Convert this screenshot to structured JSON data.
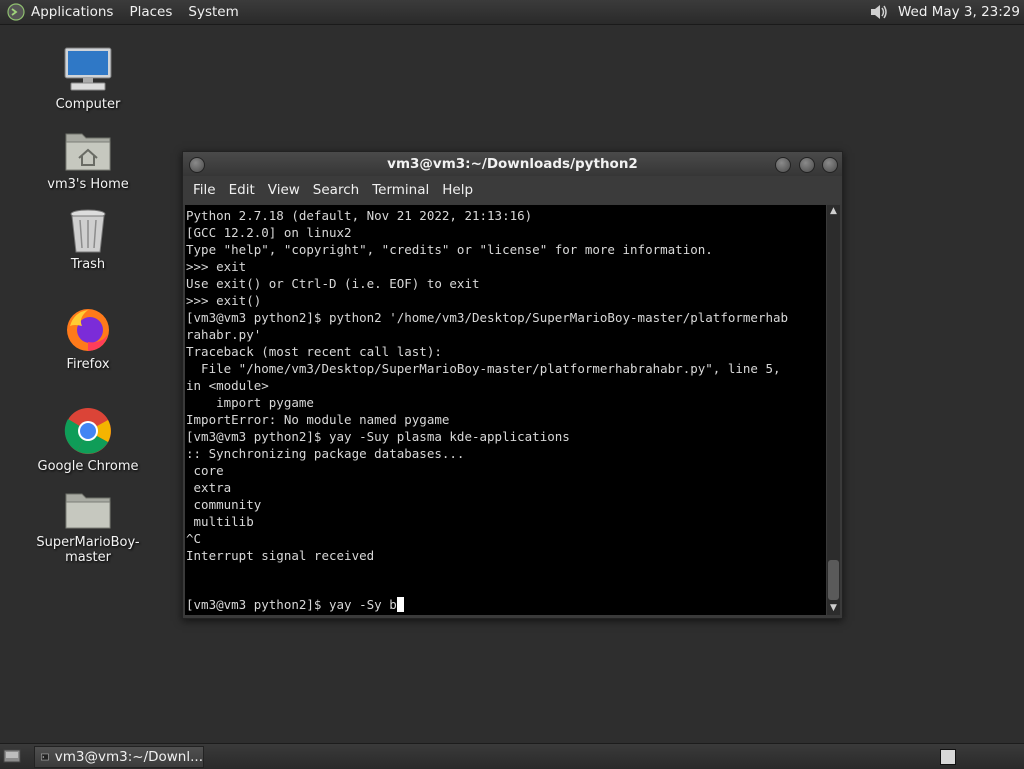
{
  "top_panel": {
    "menus": [
      "Applications",
      "Places",
      "System"
    ],
    "clock": "Wed May  3, 23:29"
  },
  "desktop_icons": [
    {
      "label": "Computer",
      "icon": "computer-icon"
    },
    {
      "label": "vm3's Home",
      "icon": "home-folder-icon"
    },
    {
      "label": "Trash",
      "icon": "trash-icon"
    },
    {
      "label": "Firefox",
      "icon": "firefox-icon"
    },
    {
      "label": "Google Chrome",
      "icon": "chrome-icon"
    },
    {
      "label": "SuperMarioBoy-master",
      "icon": "folder-icon"
    }
  ],
  "terminal": {
    "title": "vm3@vm3:~/Downloads/python2",
    "menu": [
      "File",
      "Edit",
      "View",
      "Search",
      "Terminal",
      "Help"
    ],
    "output": "Python 2.7.18 (default, Nov 21 2022, 21:13:16)\n[GCC 12.2.0] on linux2\nType \"help\", \"copyright\", \"credits\" or \"license\" for more information.\n>>> exit\nUse exit() or Ctrl-D (i.e. EOF) to exit\n>>> exit()\n[vm3@vm3 python2]$ python2 '/home/vm3/Desktop/SuperMarioBoy-master/platformerhab\nrahabr.py'\nTraceback (most recent call last):\n  File \"/home/vm3/Desktop/SuperMarioBoy-master/platformerhabrahabr.py\", line 5,\nin <module>\n    import pygame\nImportError: No module named pygame\n[vm3@vm3 python2]$ yay -Suy plasma kde-applications\n:: Synchronizing package databases...\n core\n extra\n community\n multilib\n^C\nInterrupt signal received",
    "prompt": "[vm3@vm3 python2]$ yay -Sy b"
  },
  "taskbar": {
    "task_label": "vm3@vm3:~/Downl..."
  },
  "colors": {
    "desktop_bg": "#2e2e2e",
    "terminal_bg": "#000000",
    "terminal_fg": "#d8d8d8"
  }
}
